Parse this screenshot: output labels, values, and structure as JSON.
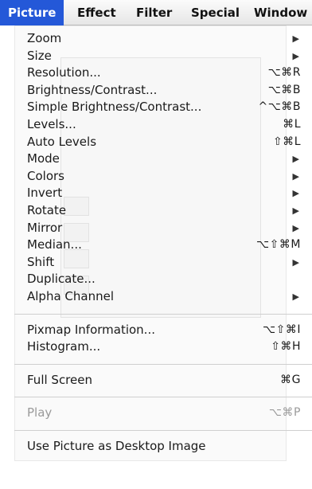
{
  "menubar": {
    "items": [
      "Picture",
      "Effect",
      "Filter",
      "Special",
      "Window"
    ],
    "active_index": 0
  },
  "menu": {
    "groups": [
      [
        {
          "label": "Zoom",
          "submenu": true
        },
        {
          "label": "Size",
          "submenu": true
        },
        {
          "label": "Resolution...",
          "shortcut": "⌥⌘R"
        },
        {
          "label": "Brightness/Contrast...",
          "shortcut": "⌥⌘B"
        },
        {
          "label": "Simple Brightness/Contrast...",
          "shortcut": "^⌥⌘B"
        },
        {
          "label": "Levels...",
          "shortcut": "⌘L"
        },
        {
          "label": "Auto Levels",
          "shortcut": "⇧⌘L"
        },
        {
          "label": "Mode",
          "submenu": true
        },
        {
          "label": "Colors",
          "submenu": true
        },
        {
          "label": "Invert",
          "submenu": true
        },
        {
          "label": "Rotate",
          "submenu": true
        },
        {
          "label": "Mirror",
          "submenu": true
        },
        {
          "label": "Median...",
          "shortcut": "⌥⇧⌘M"
        },
        {
          "label": "Shift",
          "submenu": true
        },
        {
          "label": "Duplicate..."
        },
        {
          "label": "Alpha Channel",
          "submenu": true
        }
      ],
      [
        {
          "label": "Pixmap Information...",
          "shortcut": "⌥⇧⌘I"
        },
        {
          "label": "Histogram...",
          "shortcut": "⇧⌘H"
        }
      ],
      [
        {
          "label": "Full Screen",
          "shortcut": "⌘G"
        }
      ],
      [
        {
          "label": "Play",
          "shortcut": "⌥⌘P",
          "disabled": true
        }
      ],
      [
        {
          "label": "Use Picture as Desktop Image"
        }
      ]
    ]
  },
  "colors": {
    "highlight": "#2458d8",
    "disabled_text": "#9a9a9a"
  }
}
